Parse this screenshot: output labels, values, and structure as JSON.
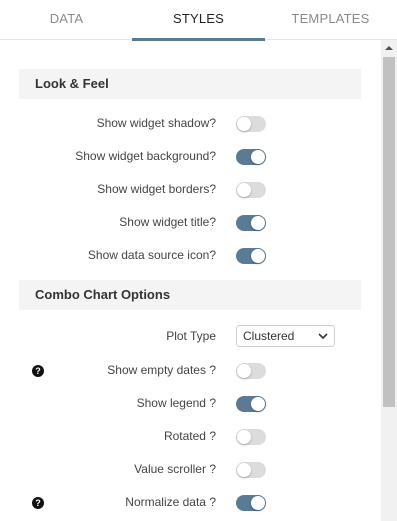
{
  "tabs": [
    {
      "label": "DATA",
      "active": false
    },
    {
      "label": "STYLES",
      "active": true
    },
    {
      "label": "TEMPLATES",
      "active": false
    }
  ],
  "look_feel": {
    "title": "Look & Feel",
    "items": [
      {
        "label": "Show widget shadow?",
        "on": false
      },
      {
        "label": "Show widget background?",
        "on": true
      },
      {
        "label": "Show widget borders?",
        "on": false
      },
      {
        "label": "Show widget title?",
        "on": true
      },
      {
        "label": "Show data source icon?",
        "on": true
      }
    ]
  },
  "combo": {
    "title": "Combo Chart Options",
    "plot_type_label": "Plot Type",
    "plot_type_value": "Clustered",
    "items": [
      {
        "label": "Show empty dates ?",
        "on": false,
        "help": true
      },
      {
        "label": "Show legend ?",
        "on": true,
        "help": false
      },
      {
        "label": "Rotated ?",
        "on": false,
        "help": false
      },
      {
        "label": "Value scroller ?",
        "on": false,
        "help": false
      },
      {
        "label": "Normalize data ?",
        "on": true,
        "help": true
      }
    ]
  },
  "help_icon_glyph": "?",
  "colors": {
    "accent": "#5b7a94",
    "toggle_off": "#dcdcdc",
    "section_bg": "#f4f4f4"
  }
}
